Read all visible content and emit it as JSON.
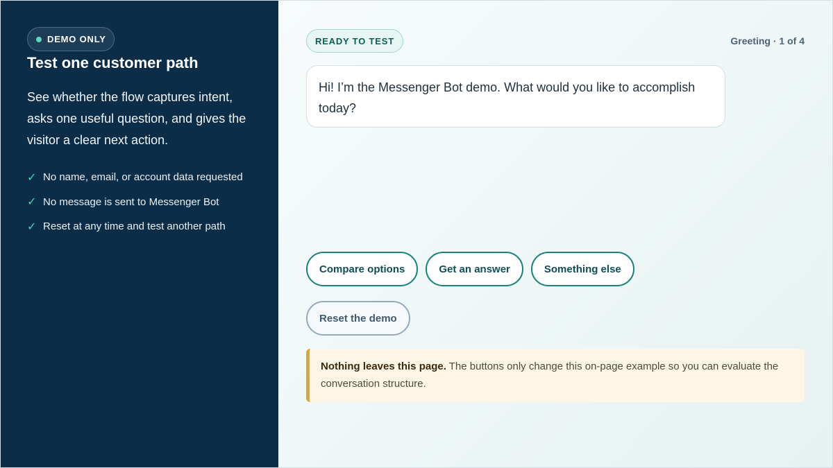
{
  "sidebar": {
    "badge": "DEMO ONLY",
    "title": "Test one customer path",
    "lead": "See whether the flow captures intent, asks one useful question, and gives the visitor a clear next action.",
    "checks": [
      {
        "icon": "checkmark-icon",
        "text": "No name, email, or account data requested"
      },
      {
        "icon": "checkmark-icon",
        "text": "No message is sent to Messenger Bot"
      },
      {
        "icon": "checkmark-icon",
        "text": "Reset at any time and test another path"
      }
    ]
  },
  "chat": {
    "status": "READY TO TEST",
    "step": "Greeting · 1 of 4",
    "bot_message": "Hi! I’m the Messenger Bot demo. What would you like to accomplish today?",
    "options": [
      "Compare options",
      "Get an answer",
      "Something else"
    ],
    "reset_label": "Reset the demo",
    "notice": {
      "strong": "Nothing leaves this page.",
      "text": " The buttons only change this on-page example so you can evaluate the conversation structure."
    }
  },
  "colors": {
    "sidebar_bg": "#0c2d48",
    "accent_teal": "#17817a",
    "check_green": "#4fd1b5",
    "notice_border": "#dba638",
    "notice_bg": "#fdf6e4"
  }
}
